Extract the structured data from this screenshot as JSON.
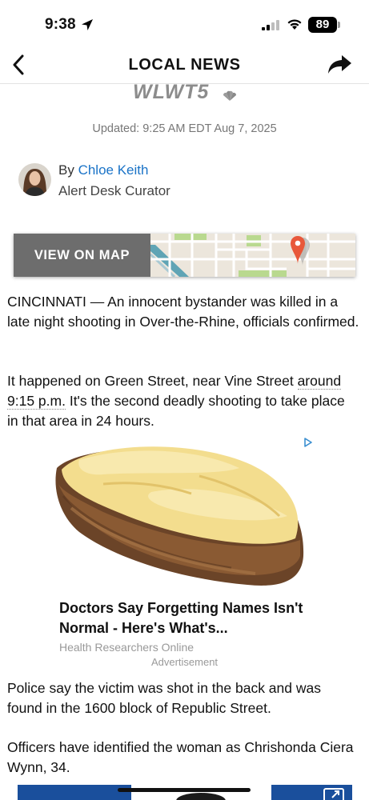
{
  "status_bar": {
    "time": "9:38",
    "battery": "89"
  },
  "nav": {
    "title": "LOCAL NEWS"
  },
  "logo": {
    "text": "WLWT5"
  },
  "article": {
    "updated": "Updated: 9:25 AM EDT Aug 7, 2025",
    "byline_prefix": "By ",
    "author": "Chloe Keith",
    "author_role": "Alert Desk Curator",
    "map_button": "VIEW ON MAP",
    "p1_dateline": "CINCINNATI —",
    "p1_text": " An innocent bystander was killed in a late night shooting in Over-the-Rhine, officials confirmed.",
    "p2_before": "It happened on Green Street, near Vine Street ",
    "p2_time": "around 9:15 p.m.",
    "p2_after": " It's the second deadly shooting to take place in that area in 24 hours.",
    "p3": "Police say the victim was shot in the back and was found in the 1600 block of Republic Street.",
    "p4": "Officers have identified the woman as Chrishonda Ciera Wynn, 34."
  },
  "ad": {
    "headline": "Doctors Say Forgetting Names Isn't Normal - Here's What's...",
    "source": "Health Researchers Online",
    "label": "Advertisement"
  },
  "colors": {
    "link": "#1a73c7",
    "map_button_bg": "#6d6d6d",
    "video_bg": "#1a4f9c"
  }
}
